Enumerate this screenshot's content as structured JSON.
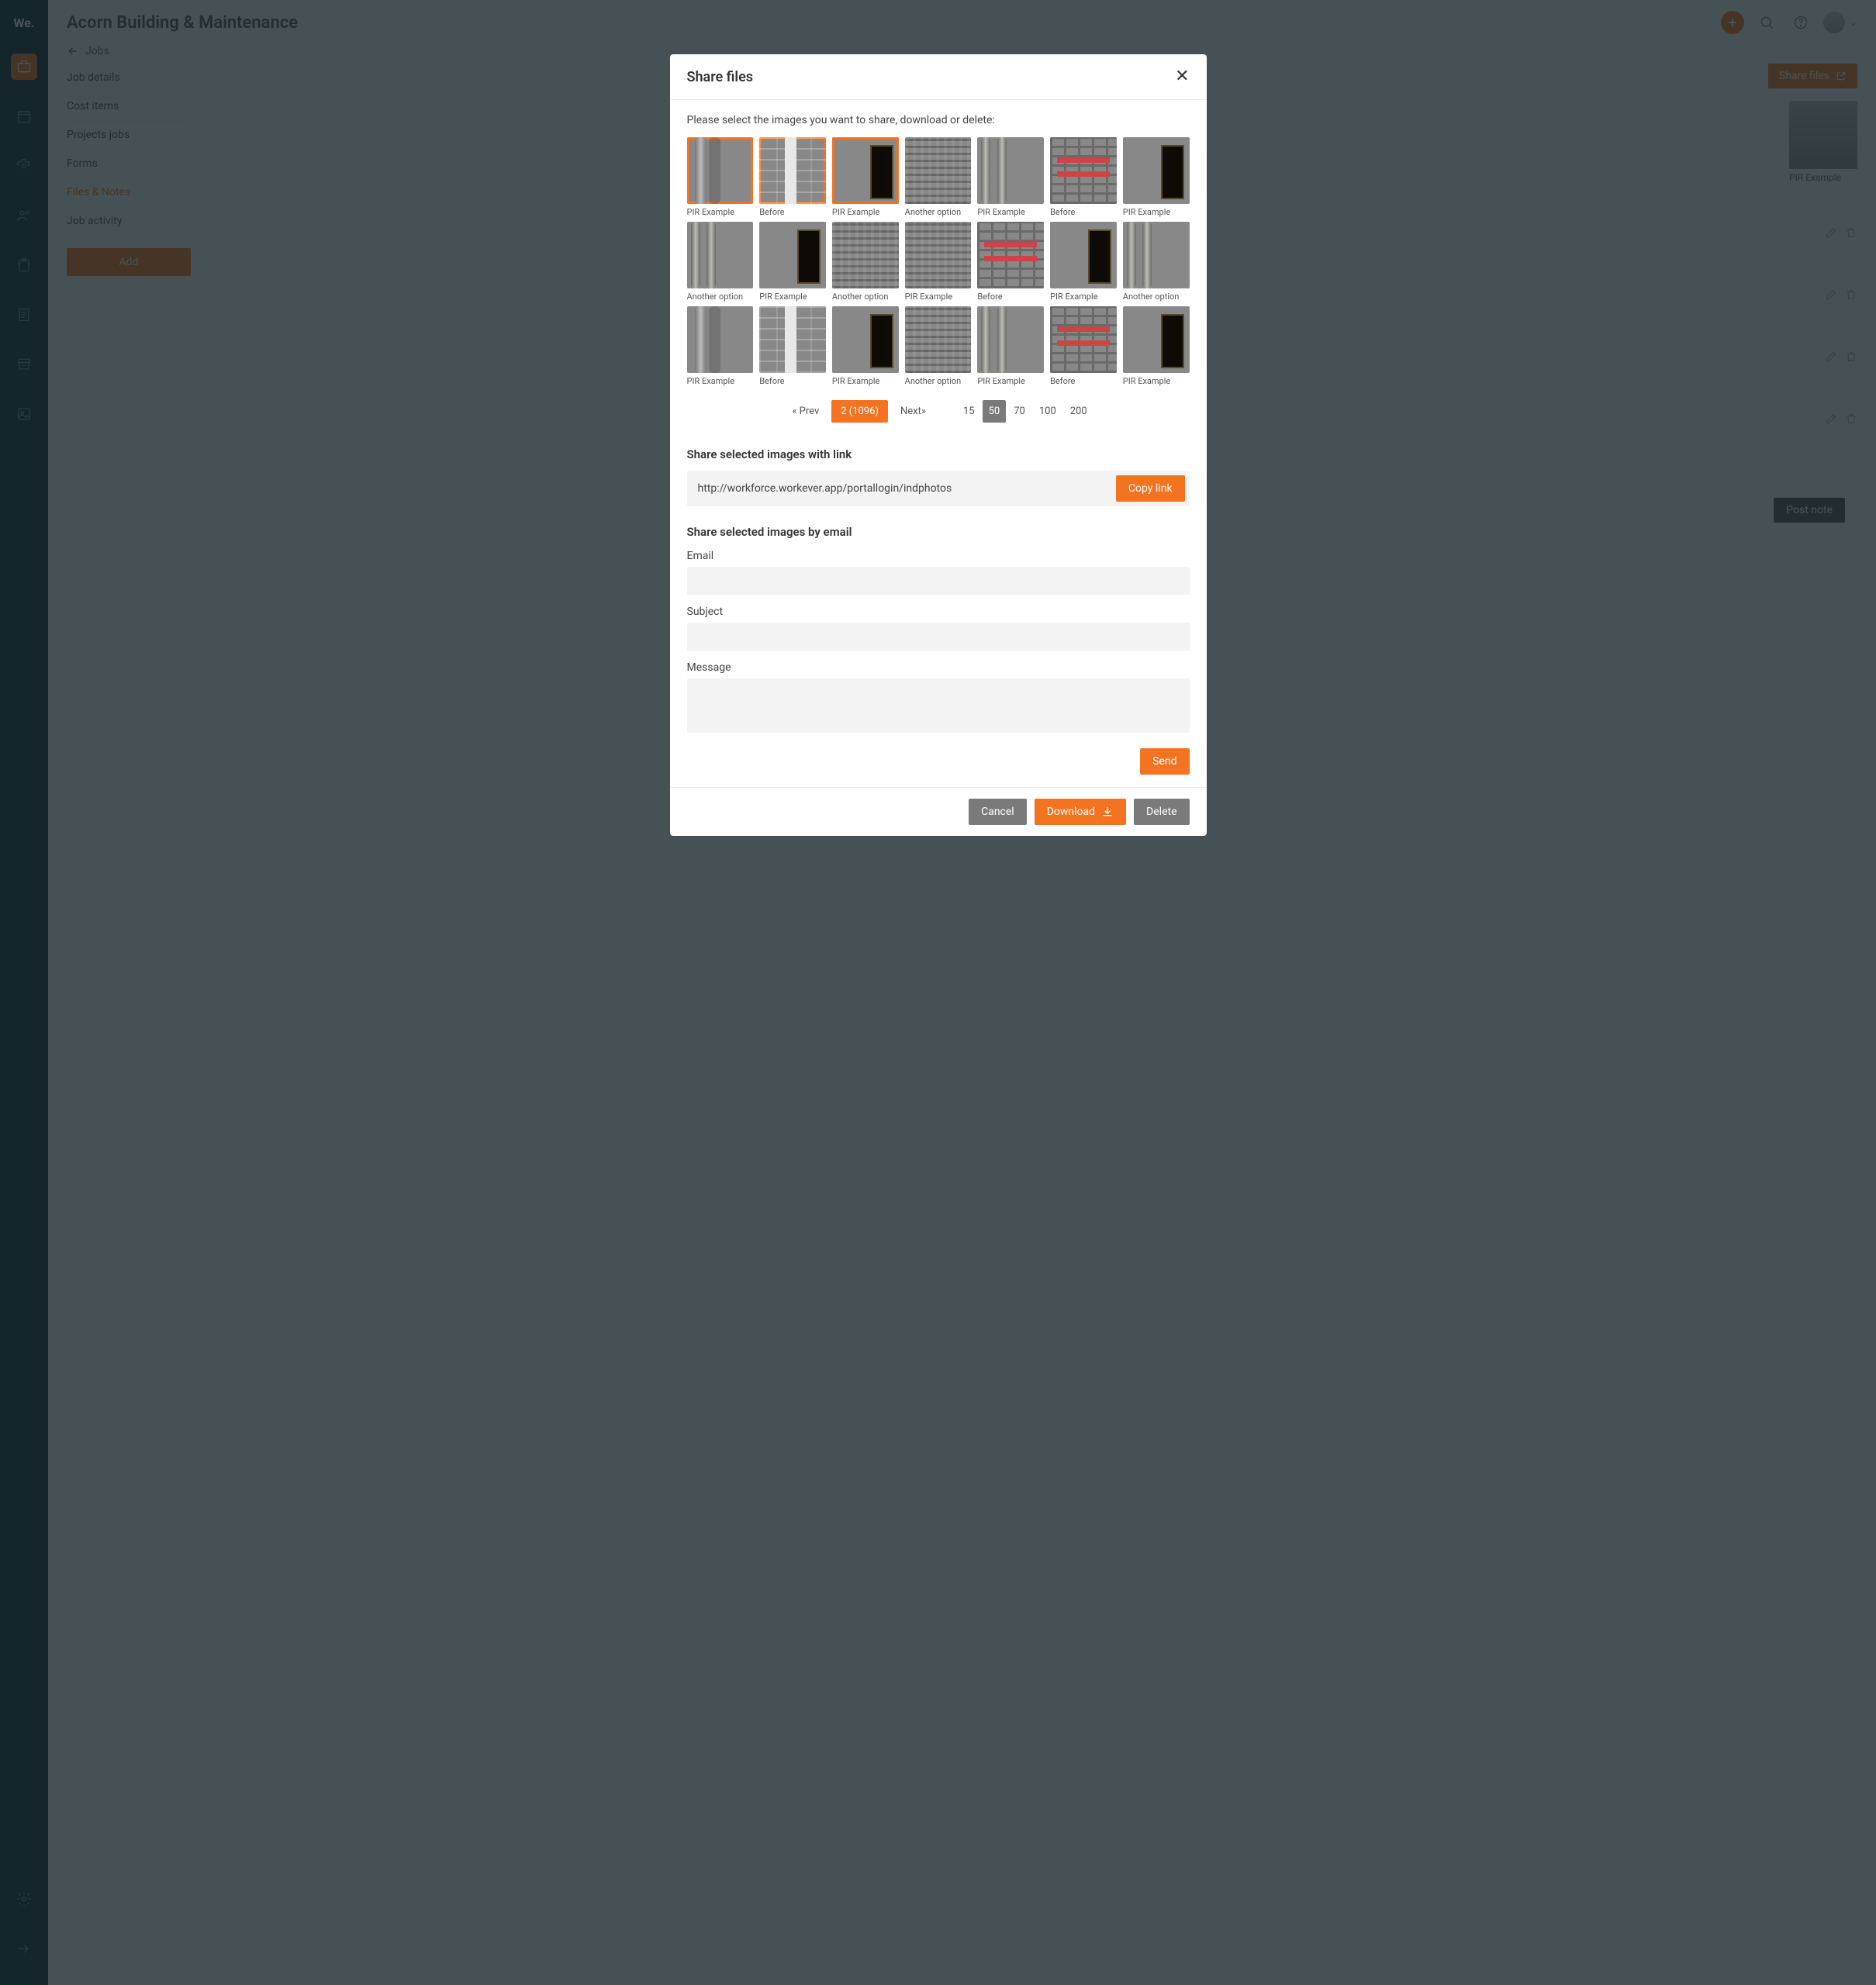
{
  "header": {
    "title": "Acorn Building & Maintenance"
  },
  "breadcrumb": {
    "label": "Jobs"
  },
  "sidebar": {
    "items": [
      {
        "label": "Job details"
      },
      {
        "label": "Cost items"
      },
      {
        "label": "Projects jobs"
      },
      {
        "label": "Forms"
      },
      {
        "label": "Files & Notes"
      },
      {
        "label": "Job activity"
      }
    ],
    "add_label": "Add "
  },
  "toolbar": {
    "share_label": "Share files",
    "post_label": "Post note"
  },
  "bg_thumb": {
    "caption": "PIR Example"
  },
  "modal": {
    "title": "Share files",
    "instruction": "Please select the images you want to share, download or delete:",
    "thumbs": [
      {
        "caption": "PIR Example",
        "selected": true,
        "tone": 0
      },
      {
        "caption": "Before",
        "selected": true,
        "tone": 1
      },
      {
        "caption": "PIR Example",
        "selected": true,
        "tone": 2
      },
      {
        "caption": "Another option",
        "selected": false,
        "tone": 3
      },
      {
        "caption": "PIR Example",
        "selected": false,
        "tone": 4
      },
      {
        "caption": "Before",
        "selected": false,
        "tone": 5
      },
      {
        "caption": "PIR Example",
        "selected": false,
        "tone": 2
      },
      {
        "caption": "Another option",
        "selected": false,
        "tone": 4
      },
      {
        "caption": "PIR Example",
        "selected": false,
        "tone": 2
      },
      {
        "caption": "Another option",
        "selected": false,
        "tone": 3
      },
      {
        "caption": "PIR Example",
        "selected": false,
        "tone": 3
      },
      {
        "caption": "Before",
        "selected": false,
        "tone": 5
      },
      {
        "caption": "PIR Example",
        "selected": false,
        "tone": 2
      },
      {
        "caption": "Another option",
        "selected": false,
        "tone": 4
      },
      {
        "caption": "PIR Example",
        "selected": false,
        "tone": 0
      },
      {
        "caption": "Before",
        "selected": false,
        "tone": 1
      },
      {
        "caption": "PIR Example",
        "selected": false,
        "tone": 2
      },
      {
        "caption": "Another option",
        "selected": false,
        "tone": 3
      },
      {
        "caption": "PIR Example",
        "selected": false,
        "tone": 4
      },
      {
        "caption": "Before",
        "selected": false,
        "tone": 5
      },
      {
        "caption": "PIR Example",
        "selected": false,
        "tone": 2
      }
    ],
    "pager": {
      "prev": "« Prev",
      "current": "2 (1096)",
      "next": "Next»",
      "sizes": [
        "15",
        "50",
        "70",
        "100",
        "200"
      ],
      "active_size": "50"
    },
    "share_link": {
      "heading": "Share selected images with link",
      "url": "http://workforce.workever.app/portallogin/indphotos",
      "copy_label": "Copy link"
    },
    "share_email": {
      "heading": "Share selected images by email",
      "email_label": "Email",
      "subject_label": "Subject",
      "message_label": "Message",
      "send_label": "Send"
    },
    "footer": {
      "cancel": "Cancel",
      "download": "Download",
      "delete": "Delete"
    }
  }
}
